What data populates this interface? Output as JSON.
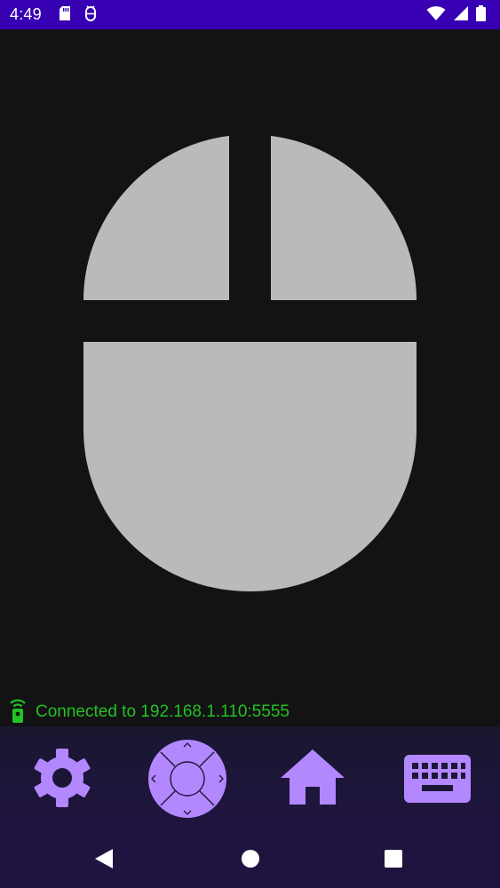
{
  "status_bar": {
    "time": "4:49",
    "left_icons": [
      "sd-card-icon",
      "android-debug-icon"
    ],
    "right_icons": [
      "wifi-icon",
      "cell-signal-icon",
      "battery-icon"
    ]
  },
  "mouse": {
    "buttons": [
      "left-click-button",
      "right-click-button",
      "touchpad"
    ]
  },
  "connection": {
    "text": "Connected to 192.168.1.110:5555",
    "icon": "remote-connected-icon",
    "color": "#22c322"
  },
  "toolbar": {
    "items": [
      "settings-icon",
      "dpad-icon",
      "home-icon",
      "keyboard-icon"
    ],
    "accent": "#b388ff"
  },
  "nav_bar": {
    "items": [
      "back-icon",
      "home-circle-icon",
      "recents-icon"
    ]
  },
  "colors": {
    "status_bar": "#3700b3",
    "background": "#131214",
    "mouse_surface": "#bab9bc",
    "toolbar_bg": "#1f1440"
  }
}
